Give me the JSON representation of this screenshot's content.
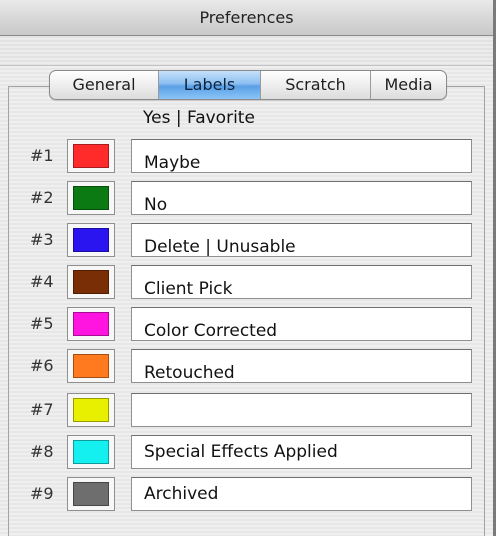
{
  "window": {
    "title": "Preferences"
  },
  "tabs": [
    {
      "label": "General",
      "active": false
    },
    {
      "label": "Labels",
      "active": true
    },
    {
      "label": "Scratch",
      "active": false
    },
    {
      "label": "Media",
      "active": false
    }
  ],
  "labels": {
    "header_text": "Yes | Favorite",
    "rows": [
      {
        "number": "#1",
        "color": "#ff2a2a",
        "text": "Maybe"
      },
      {
        "number": "#2",
        "color": "#0b7a12",
        "text": "No"
      },
      {
        "number": "#3",
        "color": "#2a14f0",
        "text": "Delete | Unusable"
      },
      {
        "number": "#4",
        "color": "#7a2e06",
        "text": "Client Pick"
      },
      {
        "number": "#5",
        "color": "#ff14e0",
        "text": "Color Corrected"
      },
      {
        "number": "#6",
        "color": "#ff7a1e",
        "text": "Retouched"
      },
      {
        "number": "#7",
        "color": "#e8f000",
        "text": ""
      },
      {
        "number": "#8",
        "color": "#14f0f0",
        "text": "Special Effects Applied"
      },
      {
        "number": "#9",
        "color": "#6e6e6e",
        "text": "Archived"
      }
    ]
  }
}
